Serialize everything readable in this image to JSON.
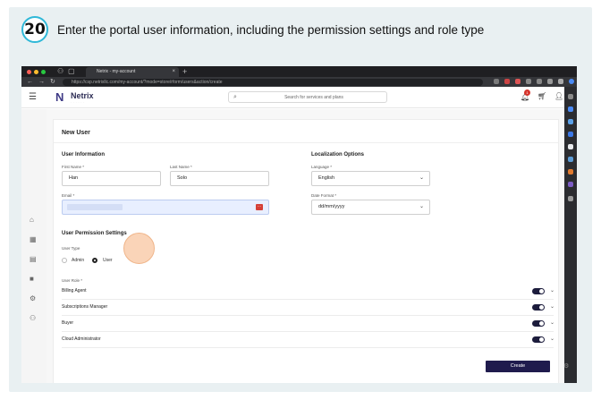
{
  "step": {
    "number": "20",
    "instruction": "Enter the portal user information, including the permission settings and role type"
  },
  "browser": {
    "tab_title": "Netrix - my-account",
    "tab_close": "×",
    "tab_plus": "+",
    "url": "https://csp.netrixllc.com/my-account/?mode=store/rform/users&action/create"
  },
  "app": {
    "brand": "Netrix",
    "brand_mark": "N",
    "brand_sub": "· · · · · ·",
    "search_placeholder": "Search for services and plans",
    "notification_count": "1"
  },
  "form": {
    "title": "New User",
    "user_info": {
      "heading": "User Information",
      "first_name_label": "First Name *",
      "first_name_value": "Han",
      "last_name_label": "Last Name *",
      "last_name_value": "Solo",
      "email_label": "Email *",
      "email_value": ""
    },
    "localization": {
      "heading": "Localization Options",
      "language_label": "Language *",
      "language_value": "English",
      "date_format_label": "Date Format *",
      "date_format_value": "dd/mm/yyyy"
    },
    "permissions": {
      "heading": "User Permission Settings",
      "user_type_label": "User Type",
      "options": [
        "Admin",
        "User"
      ],
      "selected": "User",
      "user_role_label": "User Role *",
      "roles": [
        {
          "name": "Billing Agent",
          "enabled": true
        },
        {
          "name": "Subscriptions Manager",
          "enabled": true
        },
        {
          "name": "Buyer",
          "enabled": true
        },
        {
          "name": "Cloud Administrator",
          "enabled": true
        }
      ]
    },
    "create_label": "Create"
  },
  "colors": {
    "step_ring": "#2fb8d8",
    "brand": "#3f3a86",
    "primary_button": "#1f1b4d",
    "toggle_on": "#1c1c3c",
    "click_marker": "#f8c6a0",
    "badge": "#d6342c"
  },
  "icons": {
    "hamburger": "menu-icon",
    "search": "search-icon",
    "bell": "bell-icon",
    "cart": "cart-icon",
    "user": "user-icon",
    "chevron": "chevron-down-icon",
    "sidebar": [
      "home-icon",
      "grid-icon",
      "document-icon",
      "briefcase-icon",
      "settings-icon",
      "users-icon"
    ]
  }
}
